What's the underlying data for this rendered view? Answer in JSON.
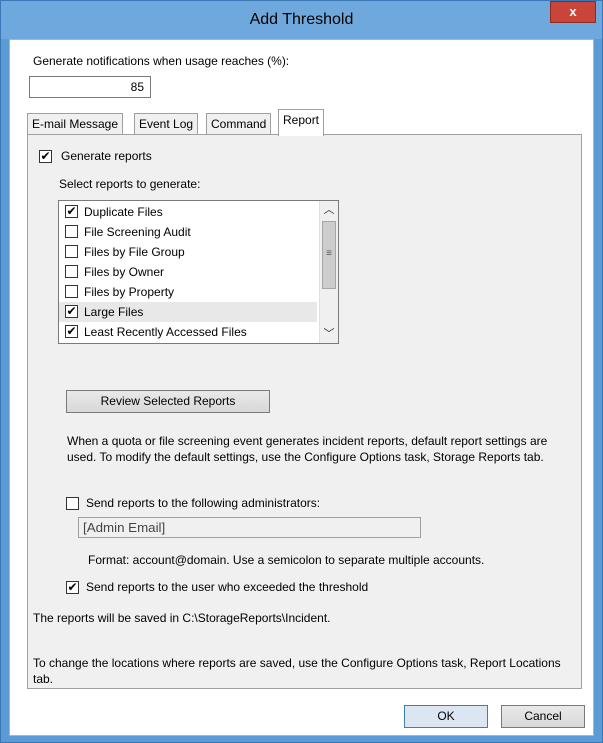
{
  "window": {
    "title": "Add Threshold",
    "close_label": "x"
  },
  "notification": {
    "label": "Generate notifications when usage reaches (%):",
    "value": "85"
  },
  "tabs": [
    {
      "label": "E-mail Message",
      "active": false
    },
    {
      "label": "Event Log",
      "active": false
    },
    {
      "label": "Command",
      "active": false
    },
    {
      "label": "Report",
      "active": true
    }
  ],
  "report": {
    "generate_reports_label": "Generate reports",
    "generate_reports_checked": true,
    "select_label": "Select reports to generate:",
    "items": [
      {
        "label": "Duplicate Files",
        "checked": true
      },
      {
        "label": "File Screening Audit",
        "checked": false
      },
      {
        "label": "Files by File Group",
        "checked": false
      },
      {
        "label": "Files by Owner",
        "checked": false
      },
      {
        "label": "Files by Property",
        "checked": false
      },
      {
        "label": "Large Files",
        "checked": true
      },
      {
        "label": "Least Recently Accessed Files",
        "checked": true
      }
    ],
    "review_button": "Review Selected Reports",
    "info_text": "When a quota or file screening event generates incident reports, default report settings are used. To modify the default settings, use the Configure Options task, Storage Reports tab.",
    "send_admins_label": "Send reports to the following administrators:",
    "send_admins_checked": false,
    "admin_email_value": "[Admin Email]",
    "format_hint": "Format: account@domain. Use a semicolon to separate multiple accounts.",
    "send_user_label": "Send reports to the user who exceeded the threshold",
    "send_user_checked": true,
    "saved_path_text": "The reports will be saved in C:\\StorageReports\\Incident.",
    "locations_text": "To change the locations where reports are saved, use the Configure Options task, Report Locations tab."
  },
  "footer": {
    "ok_label": "OK",
    "cancel_label": "Cancel"
  },
  "icons": {
    "checkmark": "checkmark-icon",
    "scroll_up": "chevron-up-icon",
    "scroll_down": "chevron-down-icon"
  }
}
